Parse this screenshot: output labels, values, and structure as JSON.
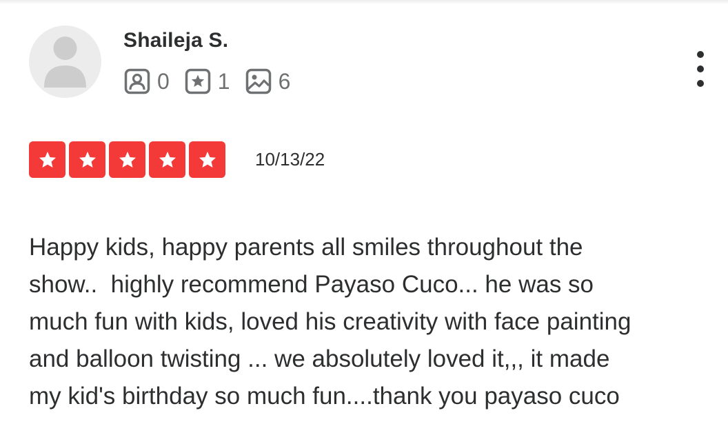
{
  "review": {
    "user": {
      "name": "Shaileja S.",
      "avatar_icon": "default-user-avatar-icon"
    },
    "stats": {
      "friends": {
        "icon": "friends-icon",
        "value": "0"
      },
      "reviews": {
        "icon": "reviews-star-icon",
        "value": "1"
      },
      "photos": {
        "icon": "photos-icon",
        "value": "6"
      }
    },
    "more_icon": "more-vertical-icon",
    "rating": {
      "stars": 5,
      "max": 5,
      "color": "#f43939"
    },
    "date": "10/13/22",
    "text_lines": [
      "Happy kids, happy parents all smiles throughout the",
      "show..  highly recommend Payaso Cuco... he was so",
      "much fun with kids, loved his creativity with face painting",
      "and balloon twisting ... we absolutely loved it,,, it made",
      "my kid's birthday so much fun....thank you payaso cuco"
    ]
  }
}
